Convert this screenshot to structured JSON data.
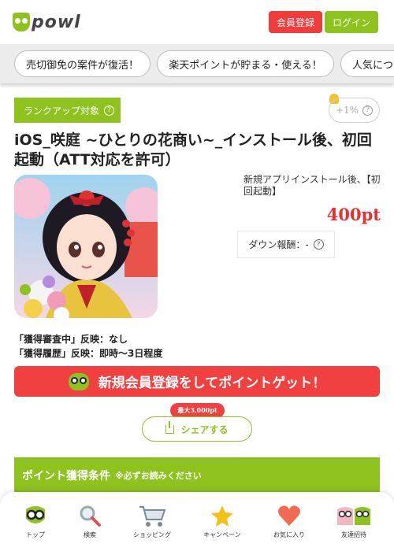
{
  "header": {
    "logo_text": "powl",
    "register_label": "会員登録",
    "login_label": "ログイン"
  },
  "chips": [
    {
      "label": "売切御免の案件が復活！"
    },
    {
      "label": "楽天ポイントが貯まる・使える！"
    },
    {
      "label": "人気につ"
    }
  ],
  "offer": {
    "rank_label": "ランクアップ対象",
    "bonus_label": "+1%",
    "title": "iOS_咲庭 ~ひとりの花商い~_インストール後、初回起動（ATT対応を許可）",
    "description": "新規アプリインストール後、【初回起動】",
    "points": "400pt",
    "down_reward_label": "ダウン報酬：-",
    "reflect_review": "「獲得審査中」反映：なし",
    "reflect_history": "「獲得履歴」反映：即時～3日程度"
  },
  "signup_banner": {
    "label": "新規会員登録をしてポイントゲット！"
  },
  "share": {
    "max_badge": "最大3,000pt",
    "label": "シェアする"
  },
  "conditions": {
    "title": "ポイント獲得条件",
    "note": "※必ずお読みください"
  },
  "nav": [
    {
      "label": "トップ",
      "icon": "owl-icon"
    },
    {
      "label": "検索",
      "icon": "search-icon"
    },
    {
      "label": "ショッピング",
      "icon": "cart-icon"
    },
    {
      "label": "キャンペーン",
      "icon": "star-icon"
    },
    {
      "label": "お気に入り",
      "icon": "heart-icon"
    },
    {
      "label": "友達招待",
      "icon": "friends-icon"
    }
  ],
  "colors": {
    "brand_green": "#8dc21f",
    "accent_red": "#f04040"
  }
}
